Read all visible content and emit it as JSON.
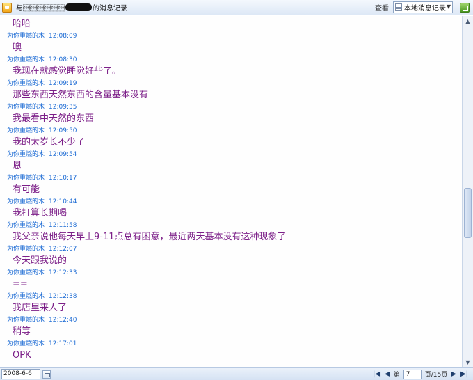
{
  "window": {
    "title_prefix": "与\u0001\u0001\u0001\u0001\u0001\u0001",
    "title_suffix": "的消息记录"
  },
  "toolbar": {
    "view_label": "查看",
    "source_value": "本地消息记录"
  },
  "messages": [
    {
      "sender": "",
      "time": "",
      "text": "哈哈"
    },
    {
      "sender": "为你重燃的木",
      "time": "12:08:09",
      "text": "噢"
    },
    {
      "sender": "为你重燃的木",
      "time": "12:08:30",
      "text": "我现在就感觉睡觉好些了。"
    },
    {
      "sender": "为你重燃的木",
      "time": "12:09:19",
      "text": "那些东西天然东西的含量基本没有"
    },
    {
      "sender": "为你重燃的木",
      "time": "12:09:35",
      "text": "我最看中天然的东西"
    },
    {
      "sender": "为你重燃的木",
      "time": "12:09:50",
      "text": "我的太岁长不少了"
    },
    {
      "sender": "为你重燃的木",
      "time": "12:09:54",
      "text": "恩"
    },
    {
      "sender": "为你重燃的木",
      "time": "12:10:17",
      "text": "有可能"
    },
    {
      "sender": "为你重燃的木",
      "time": "12:10:44",
      "text": "我打算长期喝"
    },
    {
      "sender": "为你重燃的木",
      "time": "12:11:58",
      "text": "我父亲说他每天早上9-11点总有困意，最近两天基本没有这种现象了"
    },
    {
      "sender": "为你重燃的木",
      "time": "12:12:07",
      "text": "今天跟我说的"
    },
    {
      "sender": "为你重燃的木",
      "time": "12:12:33",
      "text": "=="
    },
    {
      "sender": "为你重燃的木",
      "time": "12:12:38",
      "text": "我店里来人了"
    },
    {
      "sender": "为你重燃的木",
      "time": "12:12:40",
      "text": "稍等"
    },
    {
      "sender": "为你重燃的木",
      "time": "12:17:01",
      "text": "OPK"
    }
  ],
  "footer": {
    "date": "2008-6-6",
    "page_prefix": "第",
    "page_value": "7",
    "page_suffix": "页/15页"
  }
}
